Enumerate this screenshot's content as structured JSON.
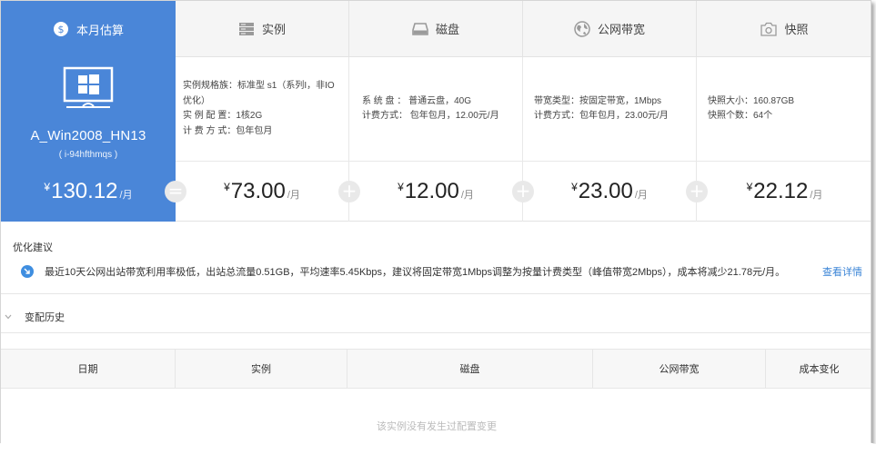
{
  "tabs": [
    {
      "label": "本月估算",
      "icon": "dollar-circle-icon",
      "active": true
    },
    {
      "label": "实例",
      "icon": "server-icon",
      "active": false
    },
    {
      "label": "磁盘",
      "icon": "disk-icon",
      "active": false
    },
    {
      "label": "公网带宽",
      "icon": "globe-icon",
      "active": false
    },
    {
      "label": "快照",
      "icon": "camera-icon",
      "active": false
    }
  ],
  "instance": {
    "icon": "windows-monitor-icon",
    "name": "A_Win2008_HN13",
    "id": "( i-94hfthmqs )"
  },
  "details": {
    "instance": {
      "spec": "实例规格族：标准型 s1（系列I，非IO优化）",
      "config": "实 例 配 置：1核2G",
      "billing": "计 费 方 式：包年包月"
    },
    "disk": {
      "system": "系 统 盘 ： 普通云盘，40G",
      "billing": "计费方式： 包年包月，12.00元/月"
    },
    "bandwidth": {
      "type": "带宽类型：按固定带宽，1Mbps",
      "billing": "计费方式：包年包月，23.00元/月"
    },
    "snapshot": {
      "size": "快照大小：160.87GB",
      "count": "快照个数：64个"
    }
  },
  "prices": {
    "currency": "¥",
    "unit": "/月",
    "total": "130.12",
    "instance": "73.00",
    "disk": "12.00",
    "bandwidth": "23.00",
    "snapshot": "22.12",
    "equals": "=",
    "plus": "+"
  },
  "optimization": {
    "title": "优化建议",
    "icon": "arrow-down-circle-icon",
    "message": "最近10天公网出站带宽利用率极低，出站总流量0.51GB，平均速率5.45Kbps，建议将固定带宽1Mbps调整为按量计费类型（峰值带宽2Mbps），成本将减少21.78元/月。",
    "link": "查看详情"
  },
  "history": {
    "title": "变配历史",
    "columns": [
      "日期",
      "实例",
      "磁盘",
      "公网带宽",
      "成本变化"
    ],
    "empty": "该实例没有发生过配置变更"
  },
  "colors": {
    "accent": "#4a86d8",
    "link": "#3a84d6"
  }
}
